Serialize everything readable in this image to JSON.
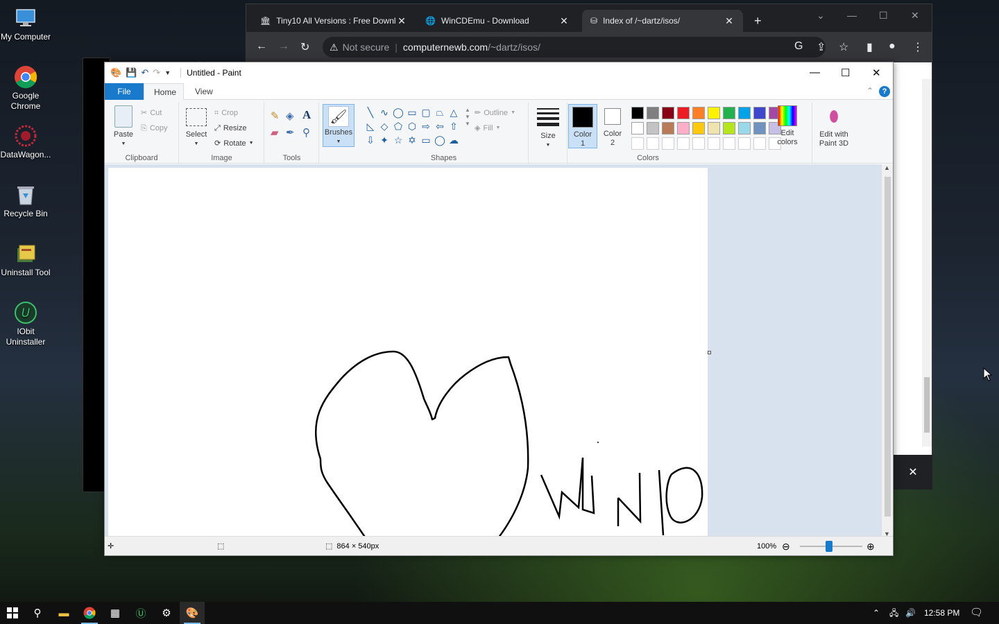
{
  "desktop": {
    "icons": [
      {
        "label": "My Computer",
        "icon": "computer-icon"
      },
      {
        "label": "Google Chrome",
        "icon": "chrome-icon"
      },
      {
        "label": "DataWagon...",
        "icon": "datawagon-icon"
      },
      {
        "label": "Recycle Bin",
        "icon": "recycle-bin-icon"
      },
      {
        "label": "Uninstall Tool",
        "icon": "uninstall-tool-icon"
      },
      {
        "label": "IObit Uninstaller",
        "icon": "iobit-icon"
      }
    ]
  },
  "chrome": {
    "tabs": [
      {
        "title": "Tiny10 All Versions : Free Downl",
        "icon": "archive-icon",
        "active": false
      },
      {
        "title": "WinCDEmu - Download",
        "icon": "globe-icon",
        "active": false
      },
      {
        "title": "Index of /~dartz/isos/",
        "icon": "server-icon",
        "active": true
      }
    ],
    "address": {
      "security": "Not secure",
      "separator": "|",
      "host": "computernewb.com",
      "path": "/~dartz/isos/"
    }
  },
  "paint": {
    "title": "Untitled - Paint",
    "tabs": {
      "file": "File",
      "home": "Home",
      "view": "View"
    },
    "clipboard": {
      "paste": "Paste",
      "cut": "Cut",
      "copy": "Copy",
      "group": "Clipboard"
    },
    "image": {
      "select": "Select",
      "crop": "Crop",
      "resize": "Resize",
      "rotate": "Rotate",
      "group": "Image"
    },
    "tools": {
      "group": "Tools"
    },
    "brushes": {
      "label": "Brushes"
    },
    "shapes": {
      "outline": "Outline",
      "fill": "Fill",
      "group": "Shapes"
    },
    "size": {
      "label": "Size"
    },
    "color1": {
      "label": "Color",
      "num": "1"
    },
    "color2": {
      "label": "Color",
      "num": "2"
    },
    "colors": {
      "group": "Colors",
      "row1": [
        "#000000",
        "#7f7f7f",
        "#880015",
        "#ed1c24",
        "#ff7f27",
        "#fff200",
        "#22b14c",
        "#00a2e8",
        "#3f48cc",
        "#a349a4"
      ],
      "row2": [
        "#ffffff",
        "#c3c3c3",
        "#b97a57",
        "#ffaec9",
        "#ffc90e",
        "#efe4b0",
        "#b5e61d",
        "#99d9ea",
        "#7092be",
        "#c8bfe7"
      ],
      "row3": [
        "#ffffff",
        "#ffffff",
        "#ffffff",
        "#ffffff",
        "#ffffff",
        "#ffffff",
        "#ffffff",
        "#ffffff",
        "#ffffff",
        "#ffffff"
      ]
    },
    "edit_colors": {
      "line1": "Edit",
      "line2": "colors"
    },
    "paint3d": {
      "line1": "Edit with",
      "line2": "Paint 3D"
    },
    "status": {
      "dimensions": "864 × 540px",
      "zoom": "100%"
    }
  },
  "taskbar": {
    "time": "12:58 PM"
  }
}
